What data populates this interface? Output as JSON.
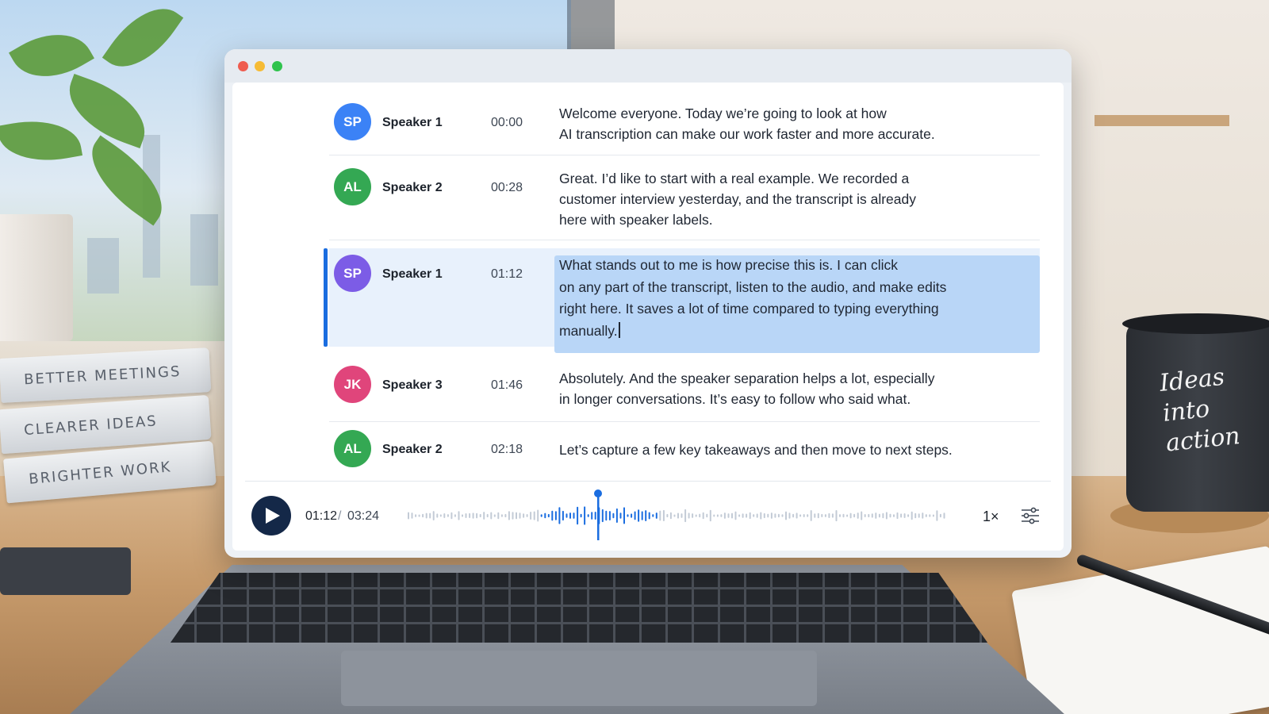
{
  "scene": {
    "books": [
      "BETTER MEETINGS",
      "CLEARER IDEAS",
      "BRIGHTER WORK"
    ],
    "mug_text": [
      "Ideas",
      "into",
      "action"
    ]
  },
  "window": {
    "controls": [
      "close",
      "minimize",
      "maximize"
    ]
  },
  "transcript": {
    "rows": [
      {
        "initials": "SP",
        "speaker": "Speaker 1",
        "time": "00:00",
        "color": "#3b82f6",
        "lines": [
          "Welcome everyone. Today we’re going to look at how",
          "AI transcription can make our work faster and more accurate."
        ]
      },
      {
        "initials": "AL",
        "speaker": "Speaker 2",
        "time": "00:28",
        "color": "#34a853",
        "lines": [
          "Great. I’d like to start with a real example. We recorded a",
          "customer interview yesterday, and the transcript is already",
          "here with speaker labels."
        ]
      },
      {
        "initials": "SP",
        "speaker": "Speaker 1",
        "time": "01:12",
        "color": "#7c5ce6",
        "active": true,
        "lines": [
          "What stands out to me is how precise this is.  I can click",
          "on any part of the transcript, listen to the audio, and make edits",
          "right here. It saves a lot of time compared to typing everything",
          "manually."
        ]
      },
      {
        "initials": "JK",
        "speaker": "Speaker 3",
        "time": "01:46",
        "color": "#e0457b",
        "lines": [
          "Absolutely. And the speaker separation helps a lot, especially",
          "in longer conversations. It’s easy to follow who said what."
        ]
      },
      {
        "initials": "AL",
        "speaker": "Speaker 2",
        "time": "02:18",
        "color": "#34a853",
        "lines": [
          "Let’s capture a few key takeaways and then move to next steps."
        ]
      }
    ]
  },
  "player": {
    "current_time": "01:12",
    "separator": "/",
    "total_time": "03:24",
    "progress": 0.353,
    "speed": "1×",
    "play_icon": "play-icon",
    "settings_icon": "sliders-icon",
    "accent": "#1a6de0"
  }
}
